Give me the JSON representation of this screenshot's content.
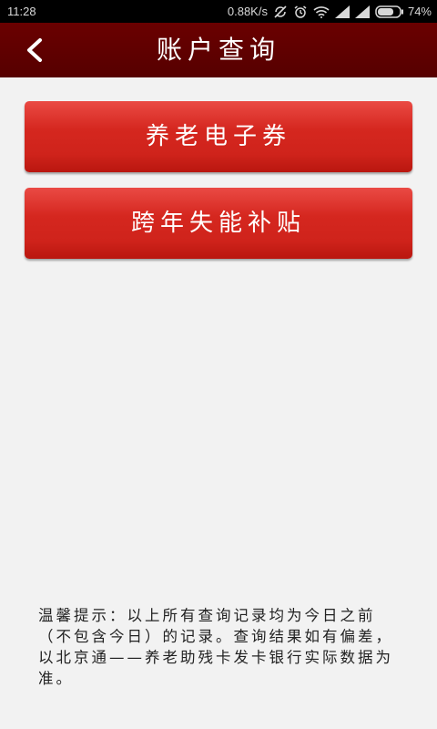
{
  "status_bar": {
    "time": "11:28",
    "network_speed": "0.88K/s",
    "battery_percent": "74%",
    "battery_level": 0.74,
    "icons": [
      "sync-off-icon",
      "alarm-icon",
      "wifi-icon",
      "signal-icon",
      "signal-icon",
      "battery-icon"
    ]
  },
  "header": {
    "back_icon": "chevron-left-icon",
    "title": "账户查询"
  },
  "menu": {
    "items": [
      {
        "label": "养老电子券"
      },
      {
        "label": "跨年失能补贴"
      }
    ]
  },
  "tip": {
    "text": "温馨提示：以上所有查询记录均为今日之前（不包含今日）的记录。查询结果如有偏差，以北京通——养老助残卡发卡银行实际数据为准。"
  },
  "colors": {
    "header_bg": "#5e0000",
    "button_red": "#d42a22",
    "page_bg": "#f2f2f2"
  }
}
